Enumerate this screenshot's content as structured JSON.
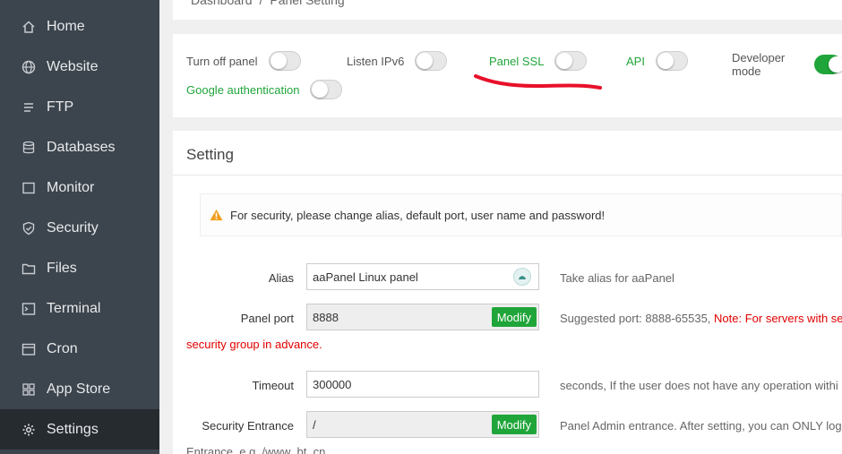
{
  "sidebar": {
    "items": [
      {
        "label": "Home",
        "icon": "home-icon"
      },
      {
        "label": "Website",
        "icon": "globe-icon"
      },
      {
        "label": "FTP",
        "icon": "ftp-icon"
      },
      {
        "label": "Databases",
        "icon": "database-icon"
      },
      {
        "label": "Monitor",
        "icon": "monitor-icon"
      },
      {
        "label": "Security",
        "icon": "shield-icon"
      },
      {
        "label": "Files",
        "icon": "folder-icon"
      },
      {
        "label": "Terminal",
        "icon": "terminal-icon"
      },
      {
        "label": "Cron",
        "icon": "cron-icon"
      },
      {
        "label": "App Store",
        "icon": "app-store-icon"
      },
      {
        "label": "Settings",
        "icon": "gear-icon",
        "active": true
      }
    ]
  },
  "breadcrumb": {
    "home": "Dashboard",
    "separator": "/",
    "current": "Panel Setting"
  },
  "toggles": {
    "turn_off_panel": {
      "label": "Turn off panel",
      "on": false
    },
    "listen_ipv6": {
      "label": "Listen IPv6",
      "on": false
    },
    "panel_ssl": {
      "label": "Panel SSL",
      "on": false
    },
    "api": {
      "label": "API",
      "on": false
    },
    "developer_mode": {
      "label": "Developer mode",
      "on": true
    },
    "google_auth": {
      "label": "Google authentication",
      "on": false
    }
  },
  "setting": {
    "title": "Setting",
    "alert": "For security, please change alias, default port, user name and password!",
    "alias": {
      "label": "Alias",
      "value": "aaPanel Linux panel",
      "hint": "Take alias for aaPanel"
    },
    "panel_port": {
      "label": "Panel port",
      "value": "8888",
      "button": "Modify",
      "hint": "Suggested port: 8888-65535, ",
      "note": "Note: For servers with sec",
      "note_cont": "security group in advance."
    },
    "timeout": {
      "label": "Timeout",
      "value": "300000",
      "hint": "seconds, If the user does not have any operation withi"
    },
    "security_entrance": {
      "label": "Security Entrance",
      "value": "/",
      "button": "Modify",
      "hint": "Panel Admin entrance. After setting, you can ONLY log",
      "hint_cont": "Entrance, e.g. /www_bt_cn"
    }
  },
  "colors": {
    "accent": "#20a53a",
    "sidebar_bg": "#3c444d",
    "sidebar_active": "#262b30",
    "warning": "#e10000"
  }
}
